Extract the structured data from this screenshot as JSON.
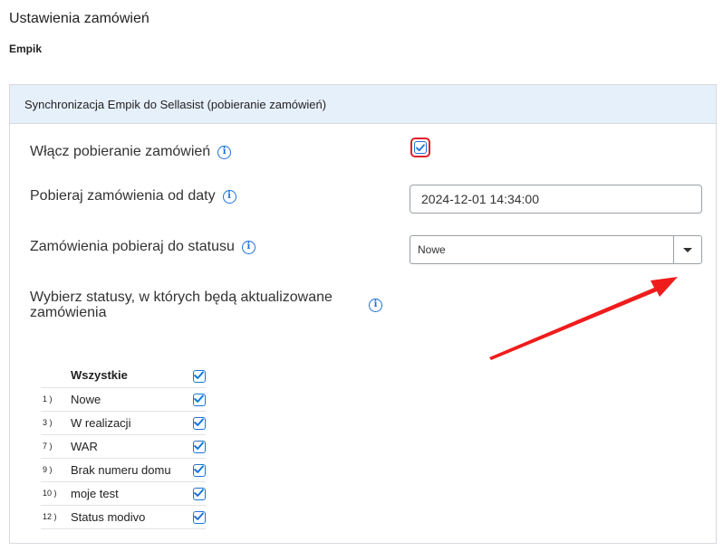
{
  "page": {
    "title": "Ustawienia zamówień",
    "subtitle": "Empik"
  },
  "panel": {
    "header": "Synchronizacja Empik do Sellasist (pobieranie zamówień)",
    "enable_label": "Włącz pobieranie zamówień",
    "enable_checked": true,
    "date_label": "Pobieraj zamówienia od daty",
    "date_value": "2024-12-01 14:34:00",
    "status_label": "Zamówienia pobieraj do statusu",
    "status_value": "Nowe",
    "update_label": "Wybierz statusy, w których będą aktualizowane zamówienia",
    "info_icon": "i"
  },
  "statuses": {
    "all_label": "Wszystkie",
    "items": [
      {
        "num": "1 )",
        "name": "Nowe",
        "checked": true
      },
      {
        "num": "3 )",
        "name": "W realizacji",
        "checked": true
      },
      {
        "num": "7 )",
        "name": "WAR",
        "checked": true
      },
      {
        "num": "9 )",
        "name": "Brak numeru domu",
        "checked": true
      },
      {
        "num": "10 )",
        "name": "moje test",
        "checked": true
      },
      {
        "num": "12 )",
        "name": "Status modivo",
        "checked": true
      }
    ]
  },
  "colors": {
    "accent": "#1a73d9",
    "highlight": "#e0202a",
    "header_bg": "#e6f0fb"
  }
}
